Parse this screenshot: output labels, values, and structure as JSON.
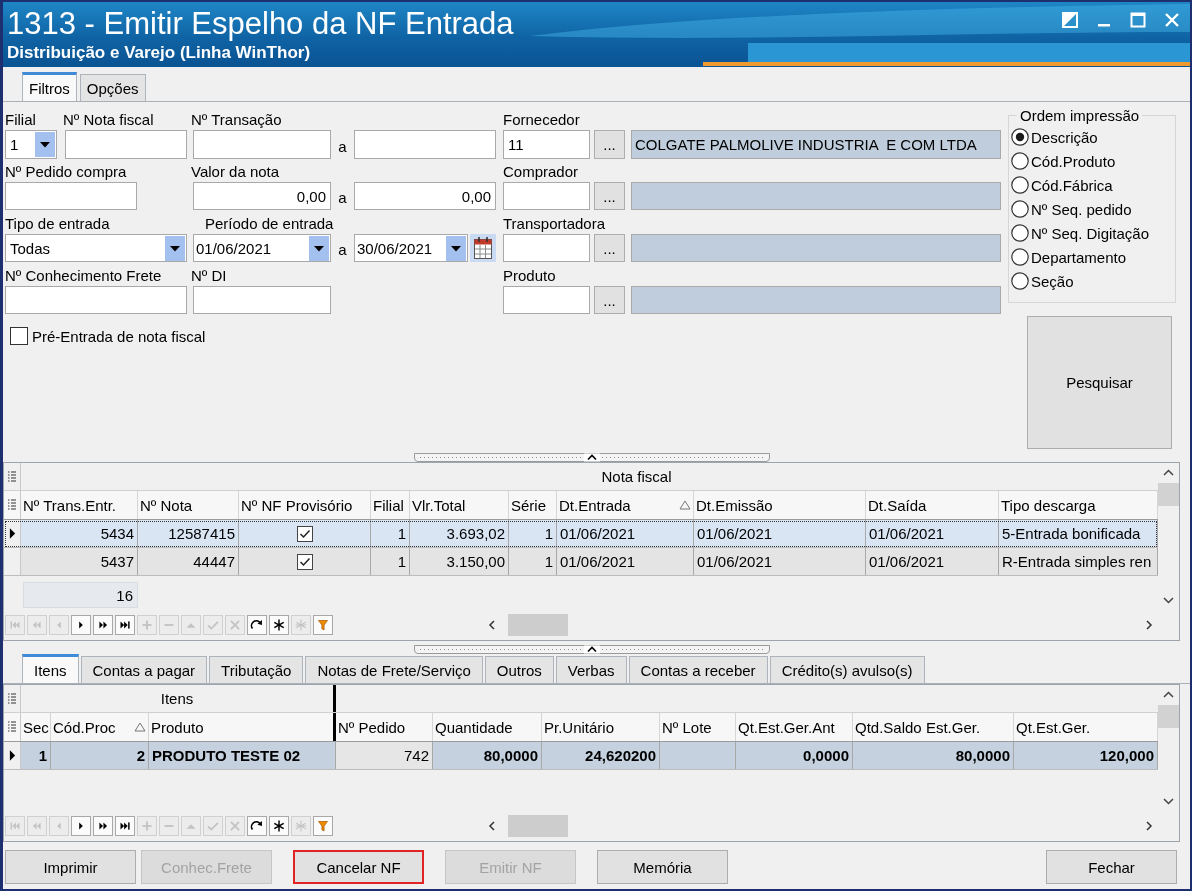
{
  "window": {
    "title": "1313 - Emitir Espelho da NF Entrada",
    "subtitle": "Distribuição e Varejo (Linha WinThor)"
  },
  "main_tabs": [
    {
      "label": "Filtros",
      "selected": true
    },
    {
      "label": "Opções",
      "selected": false
    }
  ],
  "filters": {
    "filial": {
      "label": "Filial",
      "value": "1"
    },
    "nota_fiscal": {
      "label": "Nº Nota fiscal"
    },
    "transacao": {
      "label": "Nº Transação",
      "separator": "a"
    },
    "pedido_compra": {
      "label": "Nº Pedido compra"
    },
    "valor_nota": {
      "label": "Valor da nota",
      "from": "0,00",
      "separator": "a",
      "to": "0,00"
    },
    "tipo_entrada": {
      "label": "Tipo de entrada",
      "value": "Todas"
    },
    "periodo_entrada": {
      "label": "Período de entrada",
      "from": "01/06/2021",
      "separator": "a",
      "to": "30/06/2021"
    },
    "conhecimento_frete": {
      "label": "Nº Conhecimento Frete"
    },
    "di": {
      "label": "Nº DI"
    },
    "lookups": [
      {
        "label": "Fornecedor",
        "code": "11",
        "button": "...",
        "name": "COLGATE PALMOLIVE INDUSTRIA  E COM LTDA"
      },
      {
        "label": "Comprador",
        "button": "..."
      },
      {
        "label": "Transportadora",
        "button": "..."
      },
      {
        "label": "Produto",
        "button": "..."
      }
    ],
    "pre_entrada": {
      "label": "Pré-Entrada de nota fiscal",
      "checked": false
    }
  },
  "print_order": {
    "title": "Ordem impressão",
    "options": [
      {
        "label": "Descrição",
        "selected": true
      },
      {
        "label": "Cód.Produto",
        "selected": false
      },
      {
        "label": "Cód.Fábrica",
        "selected": false
      },
      {
        "label": "Nº Seq. pedido",
        "selected": false
      },
      {
        "label": "Nº Seq. Digitação",
        "selected": false
      },
      {
        "label": "Departamento",
        "selected": false
      },
      {
        "label": "Seção",
        "selected": false
      }
    ]
  },
  "search_button": "Pesquisar",
  "invoice_grid": {
    "group_header": "Nota fiscal",
    "columns": [
      {
        "label": "Nº Trans.Entr.",
        "kind": "number",
        "sorted": false
      },
      {
        "label": "Nº Nota",
        "kind": "number",
        "sorted": false
      },
      {
        "label": "Nº NF Provisório",
        "kind": "check",
        "sorted": false
      },
      {
        "label": "Filial",
        "kind": "number",
        "sorted": false
      },
      {
        "label": "Vlr.Total",
        "kind": "number",
        "sorted": false
      },
      {
        "label": "Série",
        "kind": "number",
        "sorted": false
      },
      {
        "label": "Dt.Entrada",
        "kind": "text",
        "sorted": true
      },
      {
        "label": "Dt.Emissão",
        "kind": "text",
        "sorted": false
      },
      {
        "label": "Dt.Saída",
        "kind": "text",
        "sorted": false
      },
      {
        "label": "Tipo descarga",
        "kind": "text",
        "sorted": false
      }
    ],
    "rows": [
      {
        "selected": true,
        "cells": [
          "5434",
          "12587415",
          {
            "checked": true
          },
          "1",
          "3.693,02",
          "1",
          "01/06/2021",
          "01/06/2021",
          "01/06/2021",
          "5-Entrada bonificada"
        ]
      },
      {
        "selected": false,
        "cells": [
          "5437",
          "44447",
          {
            "checked": true
          },
          "1",
          "3.150,00",
          "1",
          "01/06/2021",
          "01/06/2021",
          "01/06/2021",
          "R-Entrada simples ren"
        ]
      }
    ],
    "summary": "16",
    "navigator": [
      {
        "kind": "first",
        "disabled": true
      },
      {
        "kind": "prev_page",
        "disabled": true
      },
      {
        "kind": "prev",
        "disabled": true
      },
      {
        "kind": "next",
        "disabled": false
      },
      {
        "kind": "next_page",
        "disabled": false
      },
      {
        "kind": "last",
        "disabled": false
      },
      {
        "kind": "insert",
        "disabled": true
      },
      {
        "kind": "delete",
        "disabled": true
      },
      {
        "kind": "edit",
        "disabled": true
      },
      {
        "kind": "post",
        "disabled": true
      },
      {
        "kind": "cancel",
        "disabled": true
      },
      {
        "kind": "refresh",
        "disabled": false
      },
      {
        "kind": "bookmark",
        "disabled": false
      },
      {
        "kind": "goto_bookmark",
        "disabled": true
      },
      {
        "kind": "filter",
        "disabled": false
      }
    ]
  },
  "detail_tabs": [
    {
      "label": "Itens",
      "selected": true
    },
    {
      "label": "Contas a pagar",
      "selected": false
    },
    {
      "label": "Tributação",
      "selected": false
    },
    {
      "label": "Notas de Frete/Serviço",
      "selected": false
    },
    {
      "label": "Outros",
      "selected": false
    },
    {
      "label": "Verbas",
      "selected": false
    },
    {
      "label": "Contas a receber",
      "selected": false
    },
    {
      "label": "Crédito(s) avulso(s)",
      "selected": false
    }
  ],
  "item_grid": {
    "group_header": "Itens",
    "columns": [
      {
        "label": "Sec",
        "kind": "number",
        "sorted": false,
        "bold": true
      },
      {
        "label": "Cód.Proc",
        "kind": "number",
        "sorted": true,
        "bold": true
      },
      {
        "label": "Produto",
        "kind": "text",
        "sorted": false,
        "bold": true
      },
      {
        "label": "Nº Pedido",
        "kind": "number",
        "sorted": false,
        "bold": false
      },
      {
        "label": "Quantidade",
        "kind": "number",
        "sorted": false,
        "bold": true
      },
      {
        "label": "Pr.Unitário",
        "kind": "number",
        "sorted": false,
        "bold": true
      },
      {
        "label": "Nº Lote",
        "kind": "text",
        "sorted": false
      },
      {
        "label": "Qt.Est.Ger.Ant",
        "kind": "number",
        "sorted": false,
        "bold": true
      },
      {
        "label": "Qtd.Saldo Est.Ger.",
        "kind": "number",
        "sorted": false,
        "bold": true
      },
      {
        "label": "Qt.Est.Ger.",
        "kind": "number",
        "sorted": false,
        "bold": true
      }
    ],
    "rows": [
      {
        "selected": true,
        "cells": [
          "1",
          "2",
          "PRODUTO TESTE 02",
          "742",
          "80,0000",
          "24,620200",
          null,
          "0,0000",
          "80,0000",
          "120,000"
        ]
      }
    ],
    "navigator": [
      {
        "kind": "first",
        "disabled": true
      },
      {
        "kind": "prev_page",
        "disabled": true
      },
      {
        "kind": "prev",
        "disabled": true
      },
      {
        "kind": "next",
        "disabled": false
      },
      {
        "kind": "next_page",
        "disabled": false
      },
      {
        "kind": "last",
        "disabled": false
      },
      {
        "kind": "insert",
        "disabled": true
      },
      {
        "kind": "delete",
        "disabled": true
      },
      {
        "kind": "edit",
        "disabled": true
      },
      {
        "kind": "post",
        "disabled": true
      },
      {
        "kind": "cancel",
        "disabled": true
      },
      {
        "kind": "refresh",
        "disabled": false
      },
      {
        "kind": "bookmark",
        "disabled": false
      },
      {
        "kind": "goto_bookmark",
        "disabled": true
      },
      {
        "kind": "filter",
        "disabled": false
      }
    ]
  },
  "footer_buttons": [
    {
      "label": "Imprimir",
      "disabled": false,
      "highlighted": false
    },
    {
      "label": "Conhec.Frete",
      "disabled": true,
      "highlighted": false
    },
    {
      "label": "Cancelar NF",
      "disabled": false,
      "highlighted": true
    },
    {
      "label": "Emitir NF",
      "disabled": true,
      "highlighted": false
    },
    {
      "label": "Memória",
      "disabled": false,
      "highlighted": false
    }
  ],
  "close_button": {
    "label": "Fechar"
  }
}
